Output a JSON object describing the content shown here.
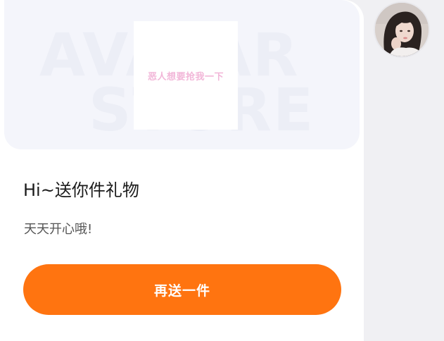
{
  "gift_card": {
    "banner": {
      "watermark_line1": "AVATAR",
      "watermark_line2": "STORE",
      "gift_image_text": "恶人想要抢我一下"
    },
    "title": "Hi~送你件礼物",
    "message": "天天开心哦!",
    "resend_button_label": "再送一件",
    "colors": {
      "accent": "#ff7410",
      "card_background": "#ffffff",
      "banner_background": "#f4f5fb"
    }
  },
  "sender": {
    "avatar_icon": "user-avatar-photo"
  }
}
